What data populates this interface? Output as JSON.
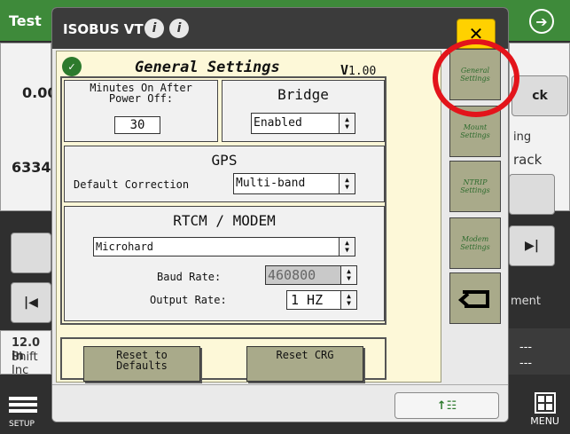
{
  "background": {
    "title": "Test",
    "left_values": [
      "0.00",
      "6334."
    ],
    "track_label": "ck",
    "track_sub1": "ing",
    "track_sub2": "rack",
    "bottom_left_value": "12.0 in",
    "bottom_left_sub": "Shift Inc",
    "right_sub": "ment",
    "dashes": [
      "---",
      "---"
    ],
    "setup_label": "SETUP",
    "menu_label": "MENU"
  },
  "modal": {
    "title": "ISOBUS VT",
    "info_glyph": "i",
    "close_glyph": "✕",
    "heading": "General Settings",
    "version_prefix": "V",
    "version_number": "1.00",
    "minutes": {
      "label_line1": "Minutes On After",
      "label_line2": "Power Off:",
      "value": "30"
    },
    "bridge": {
      "label": "Bridge",
      "value": "Enabled"
    },
    "gps": {
      "label": "GPS",
      "correction_label": "Default Correction",
      "correction_value": "Multi-band"
    },
    "rtcm": {
      "label": "RTCM / MODEM",
      "modem_value": "Microhard",
      "baud_label": "Baud Rate:",
      "baud_value": "460800",
      "output_label": "Output Rate:",
      "output_value": "1 HZ"
    },
    "reset_defaults_line1": "Reset to",
    "reset_defaults_line2": "Defaults",
    "reset_crg": "Reset CRG",
    "side_nav": [
      {
        "label": "General Settings",
        "active": true
      },
      {
        "label": "Mount Settings"
      },
      {
        "label": "NTRIP Settings"
      },
      {
        "label": "Modem Settings"
      }
    ],
    "footer_button_glyph": "↑☷"
  },
  "colors": {
    "accent_yellow": "#ffd100",
    "panel_bg": "#fdf8d8",
    "button_olive": "#a9aa8a",
    "highlight_red": "#e3141b",
    "brand_green": "#3e8a3a"
  }
}
